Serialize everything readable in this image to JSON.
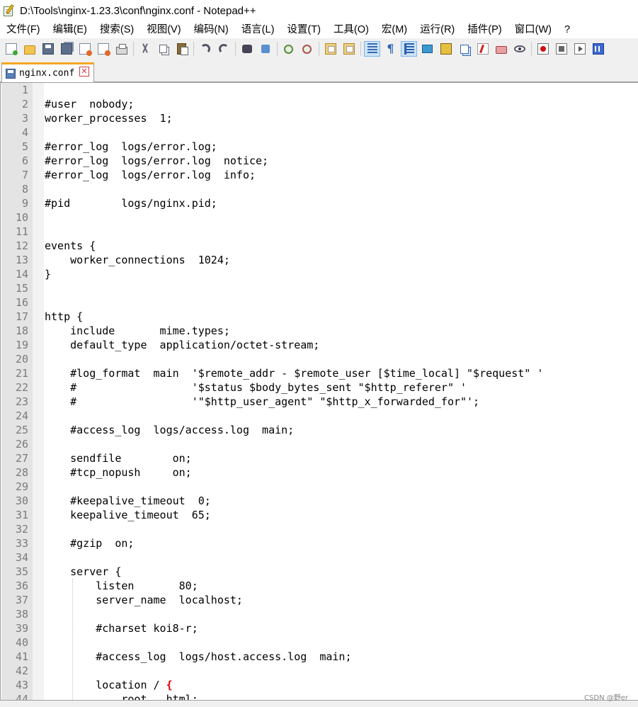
{
  "window": {
    "title": "D:\\Tools\\nginx-1.23.3\\conf\\nginx.conf - Notepad++"
  },
  "menu": [
    "文件(F)",
    "编辑(E)",
    "搜索(S)",
    "视图(V)",
    "编码(N)",
    "语言(L)",
    "设置(T)",
    "工具(O)",
    "宏(M)",
    "运行(R)",
    "插件(P)",
    "窗口(W)",
    "?"
  ],
  "toolbar": {
    "icons": [
      "new-file-icon",
      "open-file-icon",
      "save-icon",
      "save-all-icon",
      "close-icon",
      "close-all-icon",
      "print-icon",
      "cut-icon",
      "copy-icon",
      "paste-icon",
      "undo-icon",
      "redo-icon",
      "find-icon",
      "replace-icon",
      "zoom-in-icon",
      "zoom-out-icon",
      "sync-vertical-icon",
      "sync-horizontal-icon",
      "word-wrap-icon",
      "show-all-chars-icon",
      "indent-guide-icon",
      "user-language-icon",
      "document-map-icon",
      "function-list-icon",
      "folder-as-workspace-icon",
      "project-icon",
      "monitoring-icon",
      "record-macro-icon",
      "stop-record-icon",
      "play-macro-icon",
      "run-macro-multiple-icon"
    ],
    "active": [
      "word-wrap-icon",
      "indent-guide-icon"
    ]
  },
  "tab": {
    "label": "nginx.conf",
    "close": "✕"
  },
  "editor": {
    "lines": [
      "",
      "#user  nobody;",
      "worker_processes  1;",
      "",
      "#error_log  logs/error.log;",
      "#error_log  logs/error.log  notice;",
      "#error_log  logs/error.log  info;",
      "",
      "#pid        logs/nginx.pid;",
      "",
      "",
      "events {",
      "    worker_connections  1024;",
      "}",
      "",
      "",
      "http {",
      "    include       mime.types;",
      "    default_type  application/octet-stream;",
      "",
      "    #log_format  main  '$remote_addr - $remote_user [$time_local] \"$request\" '",
      "    #                  '$status $body_bytes_sent \"$http_referer\" '",
      "    #                  '\"$http_user_agent\" \"$http_x_forwarded_for\"';",
      "",
      "    #access_log  logs/access.log  main;",
      "",
      "    sendfile        on;",
      "    #tcp_nopush     on;",
      "",
      "    #keepalive_timeout  0;",
      "    keepalive_timeout  65;",
      "",
      "    #gzip  on;",
      "",
      "    server {",
      "        listen       80;",
      "        server_name  localhost;",
      "",
      "        #charset koi8-r;",
      "",
      "        #access_log  logs/host.access.log  main;",
      "",
      "        location / {",
      "            root   html;"
    ],
    "highlight_brace_line": 43
  },
  "watermark": "CSDN @野er"
}
